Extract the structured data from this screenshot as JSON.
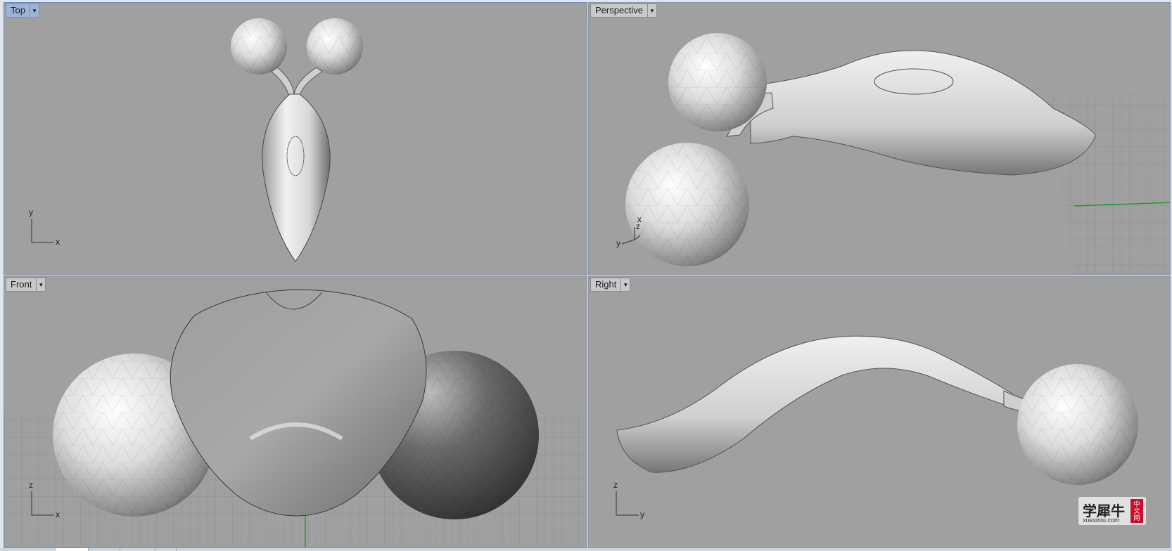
{
  "viewports": {
    "top": {
      "label": "Top",
      "axis_a": "y",
      "axis_b": "x"
    },
    "perspective": {
      "label": "Perspective",
      "axis_a": "z",
      "axis_b": "y",
      "axis_c": "x"
    },
    "front": {
      "label": "Front",
      "axis_a": "z",
      "axis_b": "x"
    },
    "right": {
      "label": "Right",
      "axis_a": "z",
      "axis_b": "y"
    }
  },
  "watermark": {
    "title": "学犀牛",
    "site": "xuexiniu.com",
    "badge_1": "中",
    "badge_2": "文",
    "badge_3": "网"
  },
  "colors": {
    "viewport_bg": "#a0a0a0",
    "active_tab": "#9db4d8",
    "grid": "#8f959c",
    "axis_green": "#1f9b2f"
  }
}
